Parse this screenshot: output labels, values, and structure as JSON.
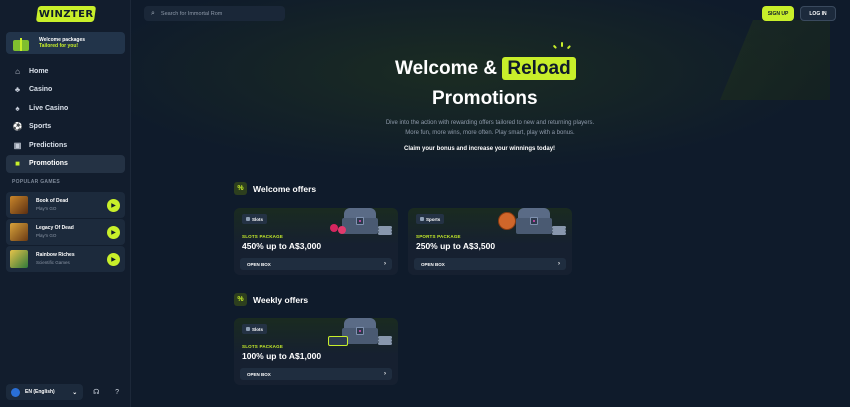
{
  "brand": {
    "logo_text": "WINZTER",
    "accent": "#c8ef2a"
  },
  "sidebar": {
    "welcome": {
      "title": "Welcome packages",
      "subtitle": "Tailored for you!"
    },
    "nav": [
      {
        "label": "Home",
        "icon": "home-icon"
      },
      {
        "label": "Casino",
        "icon": "casino-icon"
      },
      {
        "label": "Live Casino",
        "icon": "live-casino-icon"
      },
      {
        "label": "Sports",
        "icon": "sports-icon"
      },
      {
        "label": "Predictions",
        "icon": "predictions-icon"
      },
      {
        "label": "Promotions",
        "icon": "gift-icon",
        "active": true
      }
    ],
    "popular_title": "POPULAR GAMES",
    "games": [
      {
        "title": "Book of Dead",
        "provider": "Play'n GO"
      },
      {
        "title": "Legacy Of Dead",
        "provider": "Play'n GO"
      },
      {
        "title": "Rainbow Riches",
        "provider": "Scientific Games"
      }
    ],
    "language": "EN (English)"
  },
  "topbar": {
    "search_placeholder": "Search for Immortal Rom",
    "signup": "SIGN UP",
    "login": "LOG IN"
  },
  "hero": {
    "title_pre": "Welcome &",
    "title_highlight": "Reload",
    "title_line2": "Promotions",
    "desc_line1": "Dive into the action with rewarding offers tailored to new and returning players.",
    "desc_line2": "More fun, more wins, more often. Play smart, play with a bonus.",
    "claim": "Claim your bonus and increase your winnings today!"
  },
  "sections": {
    "welcome_title": "Welcome offers",
    "weekly_title": "Weekly offers"
  },
  "cards": [
    {
      "tag": "Slots",
      "package": "SLOTS PACKAGE",
      "amount": "450% up to A$3,000",
      "cta": "OPEN BOX"
    },
    {
      "tag": "Sports",
      "package": "SPORTS PACKAGE",
      "amount": "250% up to A$3,500",
      "cta": "OPEN BOX"
    },
    {
      "tag": "Slots",
      "package": "SLOTS PACKAGE",
      "amount": "100% up to A$1,000",
      "cta": "OPEN BOX"
    }
  ]
}
